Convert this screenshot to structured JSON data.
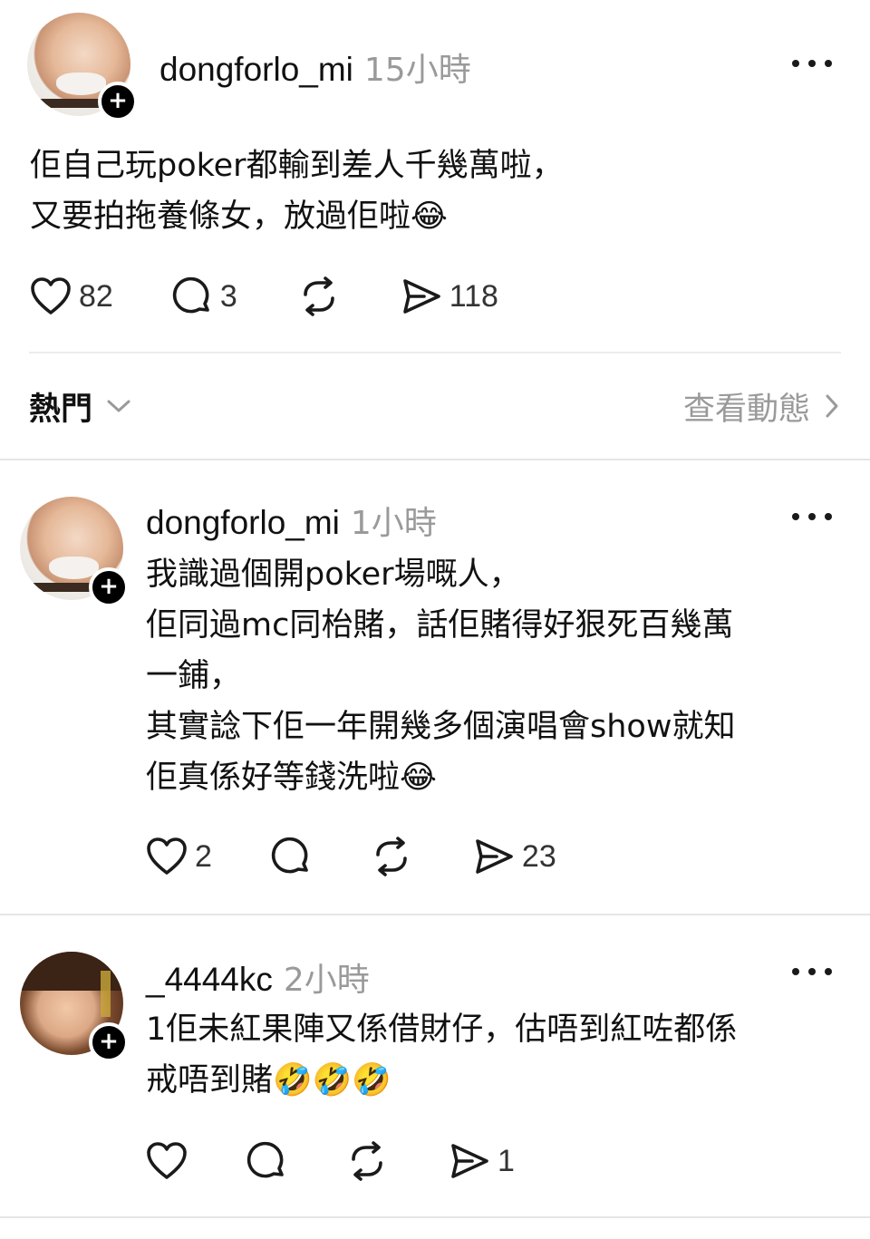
{
  "main_post": {
    "username": "dongforlo_mi",
    "time": "15小時",
    "text": "佢自己玩poker都輸到差人千幾萬啦，\n又要拍拖養條女，放過佢啦😂",
    "likes": "82",
    "replies": "3",
    "shares": "118"
  },
  "filter": {
    "sort_label": "熱門",
    "view_activity_label": "查看動態"
  },
  "replies": [
    {
      "username": "dongforlo_mi",
      "time": "1小時",
      "text": "我識過個開poker場嘅人，\n佢同過mc同枱賭，話佢賭得好狠死百幾萬\n一鋪，\n其實諗下佢一年開幾多個演唱會show就知\n佢真係好等錢洗啦😂",
      "likes": "2",
      "replies": "",
      "shares": "23"
    },
    {
      "username": "_4444kc",
      "time": "2小時",
      "text": "1佢未紅果陣又係借財仔，估唔到紅咗都係\n戒唔到賭🤣🤣🤣",
      "likes": "",
      "replies": "",
      "shares": "1"
    }
  ],
  "icons": {
    "like": "heart-icon",
    "reply": "comment-icon",
    "repost": "repost-icon",
    "share": "send-icon",
    "more": "more-icon",
    "follow": "plus-icon",
    "sort_chevron": "chevron-down-icon",
    "activity_chevron": "chevron-right-icon"
  }
}
